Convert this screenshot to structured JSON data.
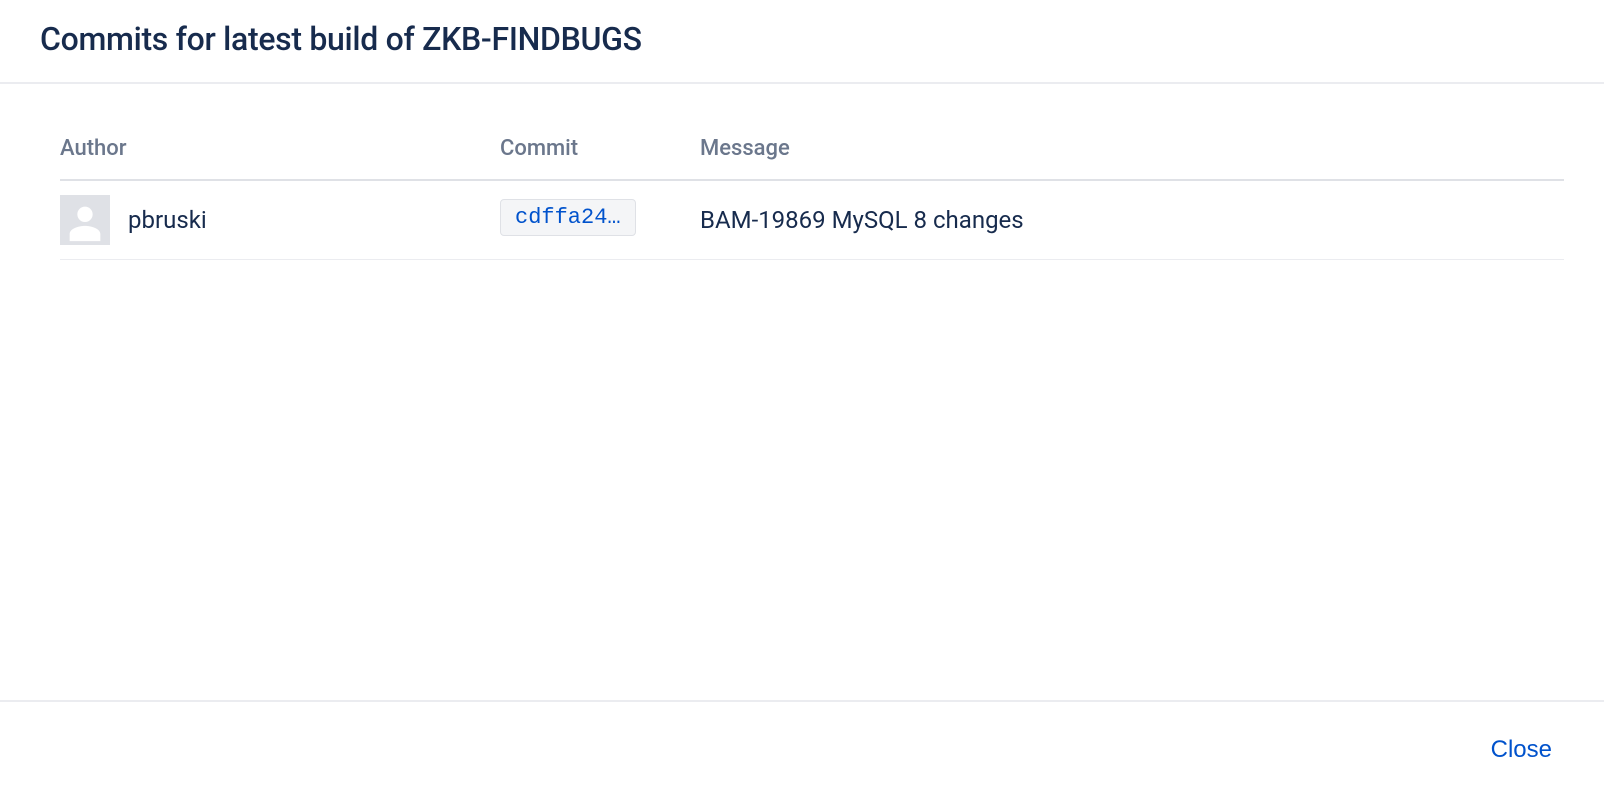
{
  "dialog": {
    "title": "Commits for latest build of ZKB-FINDBUGS",
    "close_label": "Close"
  },
  "table": {
    "headers": {
      "author": "Author",
      "commit": "Commit",
      "message": "Message"
    },
    "rows": [
      {
        "author": "pbruski",
        "commit_hash": "cdffa24…",
        "message": "BAM-19869 MySQL 8 changes"
      }
    ]
  }
}
